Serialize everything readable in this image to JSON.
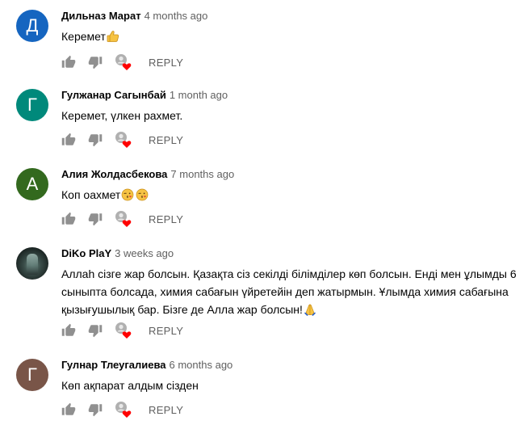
{
  "comments": [
    {
      "initial": "Д",
      "avatar_color": "#1565c0",
      "author": "Дильназ Марат",
      "time": "4 months ago",
      "text": "Керемет",
      "emoji": [
        "thumbs-up"
      ],
      "reply": "REPLY",
      "hearted": true
    },
    {
      "initial": "Г",
      "avatar_color": "#00897b",
      "author": "Гулжанар Сагынбай",
      "time": "1 month ago",
      "text": "Керемет, үлкен рахмет.",
      "emoji": [],
      "reply": "REPLY",
      "hearted": true
    },
    {
      "initial": "А",
      "avatar_color": "#33691e",
      "author": "Алия Жолдасбекова",
      "time": "7 months ago",
      "text": "Коп оахмет",
      "emoji": [
        "kiss-face",
        "kiss-face"
      ],
      "reply": "REPLY",
      "hearted": true
    },
    {
      "initial": "",
      "avatar_color": "#2c3a37",
      "author": "DiKo PlaY",
      "time": "3 weeks ago",
      "text": "Аллаh сізге жар болсын. Қазақта сіз секілді білімділер көп болсын. Енді мен ұлымды 6 сыныпта болсада, химия сабағын үйретейін деп жатырмын. Ұлымда химия сабағына қызығушылық бар. Бізге де Алла жар болсын!",
      "emoji": [
        "folded-hands"
      ],
      "reply": "REPLY",
      "hearted": true
    },
    {
      "initial": "Г",
      "avatar_color": "#795548",
      "author": "Гулнар Тлеугалиева",
      "time": "6 months ago",
      "text": "Көп ақпарат алдым сізден",
      "emoji": [],
      "reply": "REPLY",
      "hearted": true
    }
  ]
}
